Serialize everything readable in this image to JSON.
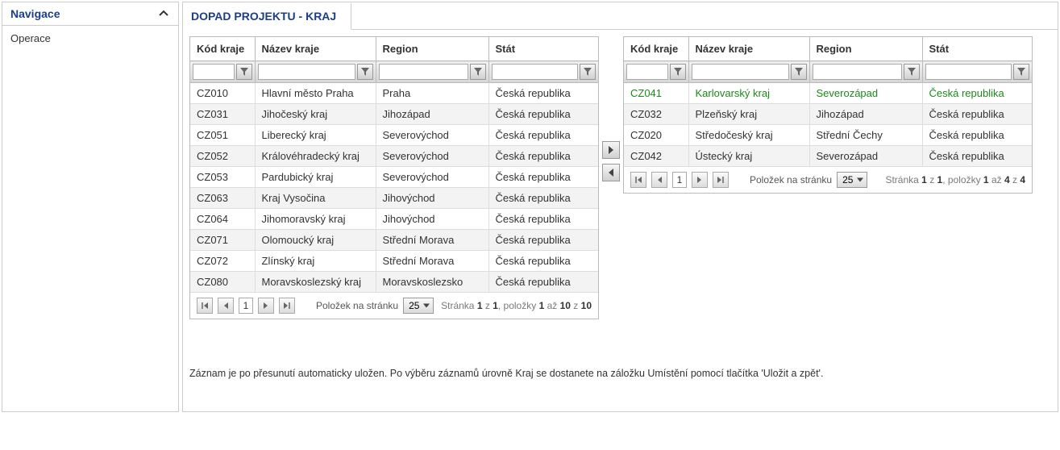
{
  "sidebar": {
    "title": "Navigace",
    "items": [
      "Operace"
    ]
  },
  "tab_title": "DOPAD PROJEKTU - KRAJ",
  "columns": {
    "code": "Kód kraje",
    "name": "Název kraje",
    "region": "Region",
    "state": "Stát"
  },
  "left_rows": [
    {
      "code": "CZ010",
      "name": "Hlavní město Praha",
      "region": "Praha",
      "state": "Česká republika"
    },
    {
      "code": "CZ031",
      "name": "Jihočeský kraj",
      "region": "Jihozápad",
      "state": "Česká republika"
    },
    {
      "code": "CZ051",
      "name": "Liberecký kraj",
      "region": "Severovýchod",
      "state": "Česká republika"
    },
    {
      "code": "CZ052",
      "name": "Královéhradecký kraj",
      "region": "Severovýchod",
      "state": "Česká republika"
    },
    {
      "code": "CZ053",
      "name": "Pardubický kraj",
      "region": "Severovýchod",
      "state": "Česká republika"
    },
    {
      "code": "CZ063",
      "name": "Kraj Vysočina",
      "region": "Jihovýchod",
      "state": "Česká republika"
    },
    {
      "code": "CZ064",
      "name": "Jihomoravský kraj",
      "region": "Jihovýchod",
      "state": "Česká republika"
    },
    {
      "code": "CZ071",
      "name": "Olomoucký kraj",
      "region": "Střední Morava",
      "state": "Česká republika"
    },
    {
      "code": "CZ072",
      "name": "Zlínský kraj",
      "region": "Střední Morava",
      "state": "Česká republika"
    },
    {
      "code": "CZ080",
      "name": "Moravskoslezský kraj",
      "region": "Moravskoslezsko",
      "state": "Česká republika"
    }
  ],
  "right_rows": [
    {
      "code": "CZ041",
      "name": "Karlovarský kraj",
      "region": "Severozápad",
      "state": "Česká republika",
      "hl": true
    },
    {
      "code": "CZ032",
      "name": "Plzeňský kraj",
      "region": "Jihozápad",
      "state": "Česká republika"
    },
    {
      "code": "CZ020",
      "name": "Středočeský kraj",
      "region": "Střední Čechy",
      "state": "Česká republika"
    },
    {
      "code": "CZ042",
      "name": "Ústecký kraj",
      "region": "Severozápad",
      "state": "Česká republika"
    }
  ],
  "pager": {
    "items_label": "Položek na stránku",
    "page_size": "25",
    "page": "1",
    "left_info_parts": [
      "Stránka ",
      "1",
      " z ",
      "1",
      ", položky ",
      "1",
      " až ",
      "10",
      " z ",
      "10"
    ],
    "right_info_parts": [
      "Stránka ",
      "1",
      " z ",
      "1",
      ", položky ",
      "1",
      " až ",
      "4",
      " z ",
      "4"
    ]
  },
  "note": "Záznam je po přesunutí automaticky uložen. Po výběru záznamů úrovně Kraj se dostanete na záložku Umístění pomocí tlačítka 'Uložit a zpět'."
}
